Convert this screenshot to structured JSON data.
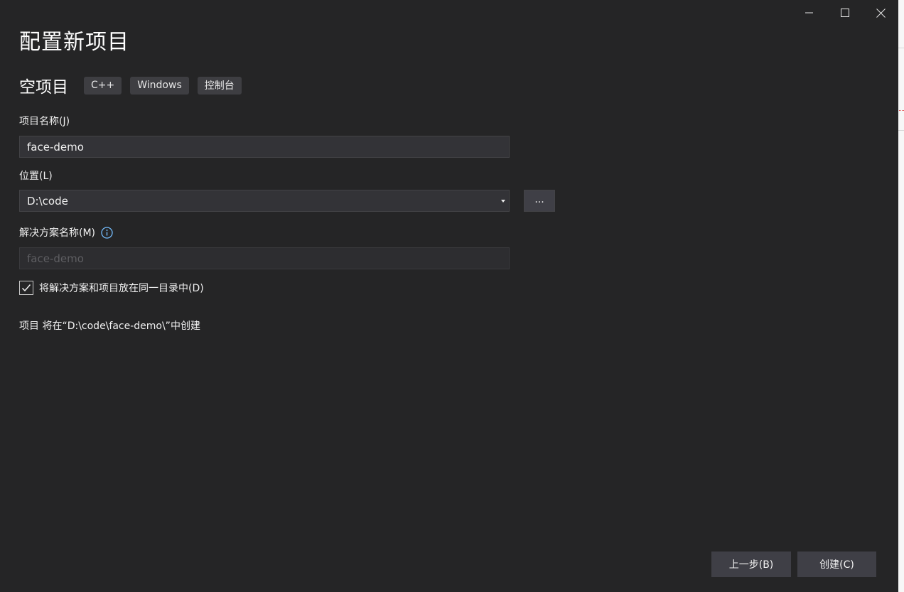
{
  "window": {
    "title": "配置新项目",
    "controls": [
      "minimize-icon",
      "maximize-icon",
      "close-icon"
    ]
  },
  "template": {
    "name": "空项目",
    "tags": [
      "C++",
      "Windows",
      "控制台"
    ]
  },
  "project_name": {
    "label": "项目名称(J)",
    "value": "face-demo"
  },
  "location": {
    "label": "位置(L)",
    "value": "D:\\code",
    "browse_label": "..."
  },
  "solution_name": {
    "label": "解决方案名称(M)",
    "placeholder": "face-demo",
    "info_icon": "info-icon"
  },
  "same_directory": {
    "label": "将解决方案和项目放在同一目录中(D)",
    "checked": true
  },
  "summary": "项目 将在“D:\\code\\face-demo\\”中创建",
  "footer": {
    "back_label": "上一步(B)",
    "create_label": "创建(C)"
  },
  "colors": {
    "background": "#252526",
    "input": "#333337",
    "button": "#3f3f46",
    "info_accent": "#75beff"
  }
}
